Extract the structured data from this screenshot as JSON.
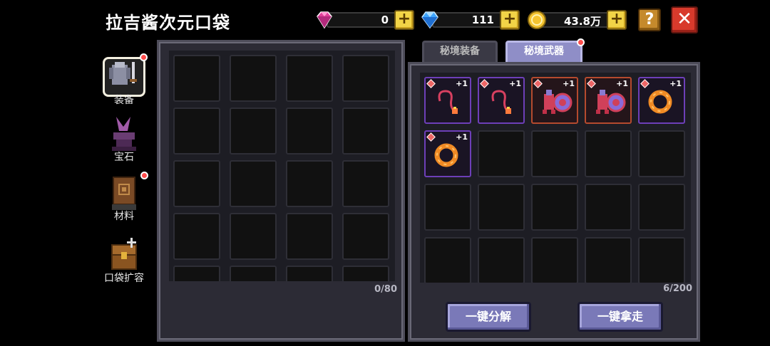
{
  "header": {
    "title": "拉吉酱次元口袋"
  },
  "currencies": [
    {
      "name": "pink-gem",
      "value": "0"
    },
    {
      "name": "blue-gem",
      "value": "111"
    },
    {
      "name": "gold-coin",
      "value": "43.8万"
    }
  ],
  "controls": {
    "help": "?",
    "close": "✕",
    "plus": "+"
  },
  "sidebar": {
    "items": [
      {
        "label": "装备",
        "active": true,
        "badge": true
      },
      {
        "label": "宝石",
        "active": false,
        "badge": false
      },
      {
        "label": "材料",
        "active": false,
        "badge": true
      },
      {
        "label": "口袋扩容",
        "active": false,
        "badge": false
      }
    ]
  },
  "left_panel": {
    "count": "0/80"
  },
  "right_panel": {
    "tabs": [
      {
        "label": "秘境装备",
        "selected": false
      },
      {
        "label": "秘境武器",
        "selected": true
      }
    ],
    "count": "6/200",
    "items": [
      {
        "type": "whip",
        "rarity": "purple",
        "level": "+1"
      },
      {
        "type": "whip",
        "rarity": "purple",
        "level": "+1"
      },
      {
        "type": "shield",
        "rarity": "orange",
        "level": "+1"
      },
      {
        "type": "shield",
        "rarity": "orange",
        "level": "+1"
      },
      {
        "type": "ring",
        "rarity": "purple",
        "level": "+1"
      },
      {
        "type": "ring",
        "rarity": "purple",
        "level": "+1"
      }
    ]
  },
  "actions": {
    "decompose": "一键分解",
    "take_all": "一键拿走"
  }
}
